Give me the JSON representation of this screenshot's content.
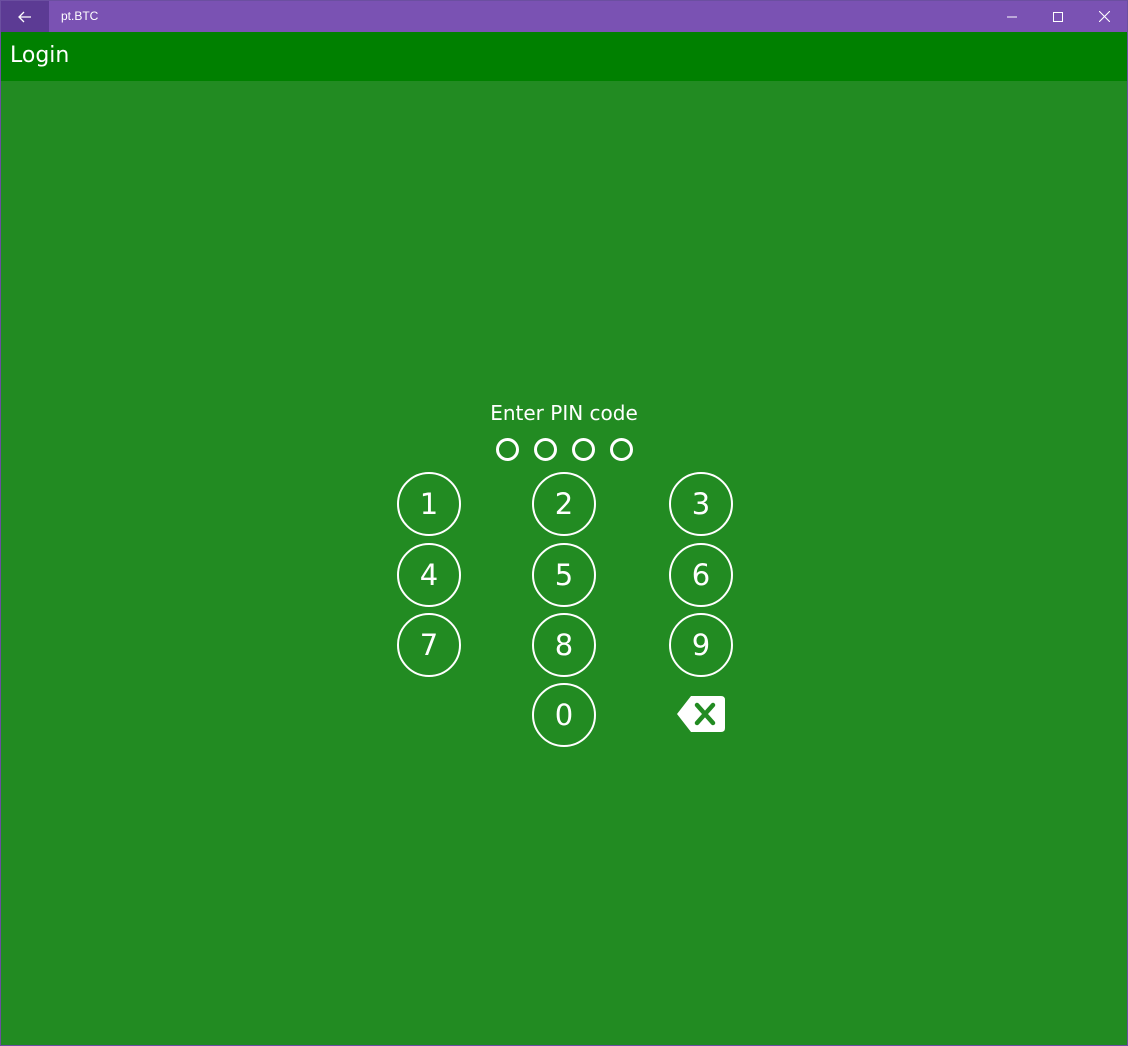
{
  "window": {
    "title": "pt.BTC",
    "controls": {
      "back_icon": "arrow-left-icon",
      "minimize_icon": "minimize-icon",
      "maximize_icon": "maximize-icon",
      "close_icon": "close-icon"
    }
  },
  "header": {
    "title": "Login"
  },
  "pin": {
    "label": "Enter PIN code",
    "length": 4,
    "entered": 0
  },
  "keypad": {
    "keys": [
      "1",
      "2",
      "3",
      "4",
      "5",
      "6",
      "7",
      "8",
      "9",
      "0"
    ],
    "backspace_icon": "backspace-icon"
  },
  "colors": {
    "titlebar": "#7a52b3",
    "back_button": "#5c3b94",
    "header": "#008000",
    "background": "#228b22",
    "foreground": "#ffffff"
  }
}
